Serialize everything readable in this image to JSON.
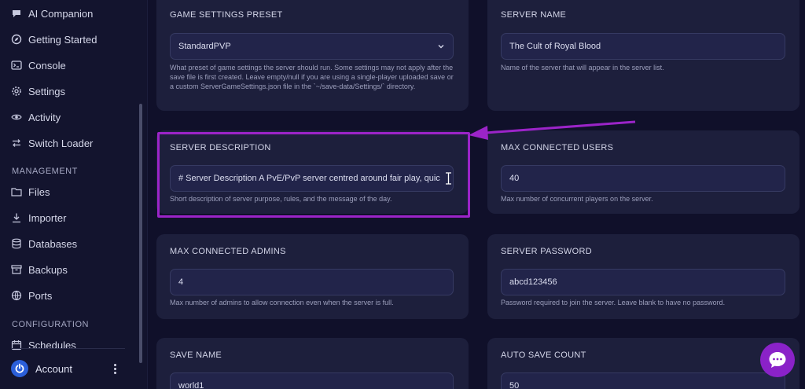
{
  "sidebar": {
    "items": [
      {
        "label": "AI Companion"
      },
      {
        "label": "Getting Started"
      },
      {
        "label": "Console"
      },
      {
        "label": "Settings"
      },
      {
        "label": "Activity"
      },
      {
        "label": "Switch Loader"
      }
    ],
    "management_label": "MANAGEMENT",
    "management_items": [
      {
        "label": "Files"
      },
      {
        "label": "Importer"
      },
      {
        "label": "Databases"
      },
      {
        "label": "Backups"
      },
      {
        "label": "Ports"
      }
    ],
    "configuration_label": "CONFIGURATION",
    "configuration_items": [
      {
        "label": "Schedules"
      }
    ],
    "account_label": "Account"
  },
  "settings": {
    "game_preset": {
      "label": "GAME SETTINGS PRESET",
      "value": "StandardPVP",
      "help": "What preset of game settings the server should run. Some settings may not apply after the save file is first created. Leave empty/null if you are using a single-player uploaded save or a custom ServerGameSettings.json file in the `~/save-data/Settings/` directory."
    },
    "server_name": {
      "label": "SERVER NAME",
      "value": "The Cult of Royal Blood",
      "help": "Name of the server that will appear in the server list."
    },
    "server_description": {
      "label": "SERVER DESCRIPTION",
      "value": "# Server Description A PvE/PvP server centred around fair play, quic",
      "help": "Short description of server purpose, rules, and the message of the day."
    },
    "max_users": {
      "label": "MAX CONNECTED USERS",
      "value": "40",
      "help": "Max number of concurrent players on the server."
    },
    "max_admins": {
      "label": "MAX CONNECTED ADMINS",
      "value": "4",
      "help": "Max number of admins to allow connection even when the server is full."
    },
    "server_password": {
      "label": "SERVER PASSWORD",
      "value": "abcd123456",
      "help": "Password required to join the server. Leave blank to have no password."
    },
    "save_name": {
      "label": "SAVE NAME",
      "value": "world1"
    },
    "auto_save_count": {
      "label": "AUTO SAVE COUNT",
      "value": "50"
    }
  },
  "colors": {
    "accent": "#9b24c8",
    "background": "#10102a",
    "card": "#1d1f3c"
  }
}
